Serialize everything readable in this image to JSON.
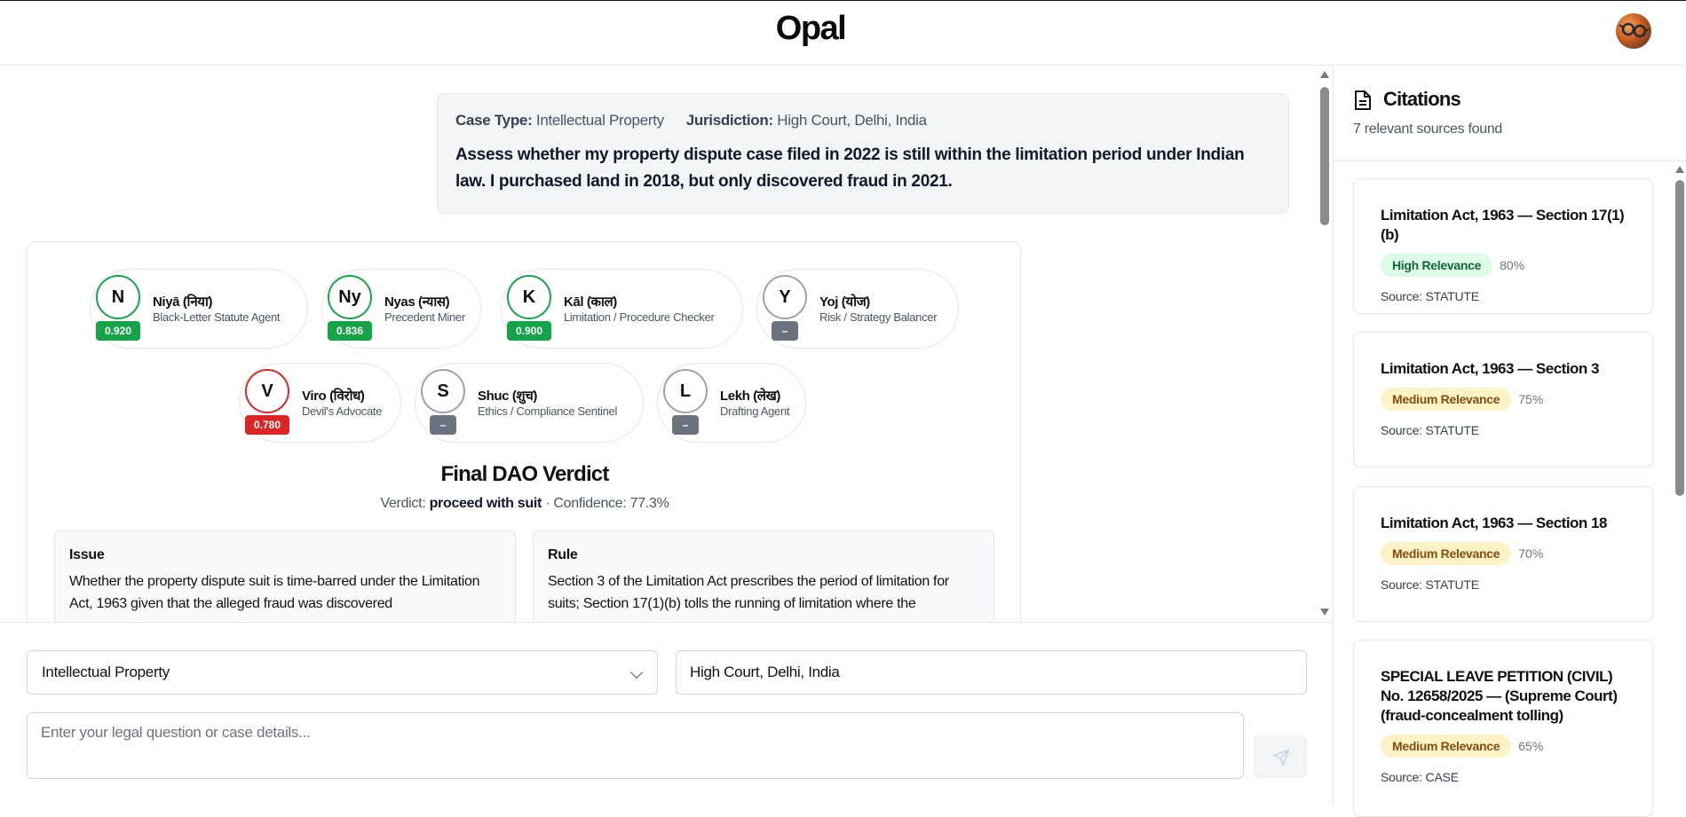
{
  "app": {
    "title": "Opal"
  },
  "query": {
    "case_type_label": "Case Type:",
    "case_type_value": "Intellectual Property",
    "jurisdiction_label": "Jurisdiction:",
    "jurisdiction_value": "High Court, Delhi, India",
    "text": "Assess whether my property dispute case filed in 2022 is still within the limitation period under Indian law. I purchased land in 2018, but only discovered fraud in 2021."
  },
  "agents": [
    {
      "initial": "N",
      "name": "Niyā (निया)",
      "role": "Black-Letter Statute Agent",
      "score": "0.920",
      "status": "green"
    },
    {
      "initial": "Ny",
      "name": "Nyas (न्यास)",
      "role": "Precedent Miner",
      "score": "0.836",
      "status": "green"
    },
    {
      "initial": "K",
      "name": "Kāl (काल)",
      "role": "Limitation / Procedure Checker",
      "score": "0.900",
      "status": "green"
    },
    {
      "initial": "Y",
      "name": "Yoj (योज)",
      "role": "Risk / Strategy Balancer",
      "score": "–",
      "status": "gray"
    },
    {
      "initial": "V",
      "name": "Viro (विरोध)",
      "role": "Devil's Advocate",
      "score": "0.780",
      "status": "red"
    },
    {
      "initial": "S",
      "name": "Shuc (शुच)",
      "role": "Ethics / Compliance Sentinel",
      "score": "–",
      "status": "gray"
    },
    {
      "initial": "L",
      "name": "Lekh (लेख)",
      "role": "Drafting Agent",
      "score": "–",
      "status": "gray"
    }
  ],
  "verdict": {
    "title": "Final DAO Verdict",
    "verdict_label": "Verdict:",
    "verdict_value": "proceed with suit",
    "separator": "·",
    "confidence_label": "Confidence:",
    "confidence_value": "77.3%",
    "issue_heading": "Issue",
    "issue_text": "Whether the property dispute suit is time-barred under the Limitation Act, 1963 given that the alleged fraud was discovered",
    "rule_heading": "Rule",
    "rule_text": "Section 3 of the Limitation Act prescribes the period of limitation for suits; Section 17(1)(b) tolls the running of limitation where the"
  },
  "composer": {
    "case_type_selected": "Intellectual Property",
    "jurisdiction_value": "High Court, Delhi, India",
    "question_placeholder": "Enter your legal question or case details..."
  },
  "citations": {
    "title": "Citations",
    "subtitle": "7 relevant sources found",
    "items": [
      {
        "title": "Limitation Act, 1963 — Section 17(1)(b)",
        "relevance": "High Relevance",
        "percent": "80%",
        "source": "Source: STATUTE"
      },
      {
        "title": "Limitation Act, 1963 — Section 3",
        "relevance": "Medium Relevance",
        "percent": "75%",
        "source": "Source: STATUTE"
      },
      {
        "title": "Limitation Act, 1963 — Section 18",
        "relevance": "Medium Relevance",
        "percent": "70%",
        "source": "Source: STATUTE"
      },
      {
        "title": "SPECIAL LEAVE PETITION (CIVIL) No. 12658/2025 — (Supreme Court) (fraud-concealment tolling)",
        "relevance": "Medium Relevance",
        "percent": "65%",
        "source": "Source: CASE"
      }
    ]
  },
  "colors": {
    "green": "#16a34a",
    "red": "#dc2626",
    "gray": "#6b7280"
  }
}
